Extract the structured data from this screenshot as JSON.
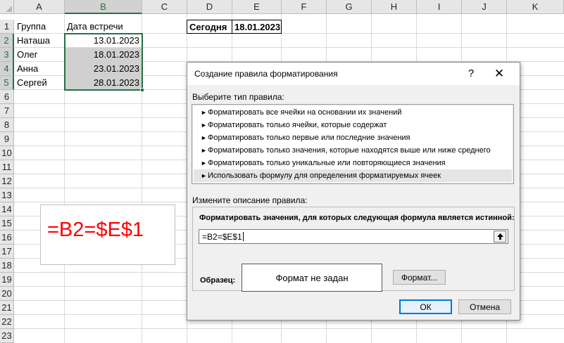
{
  "sheet": {
    "columns": [
      "A",
      "B",
      "C",
      "D",
      "E",
      "F",
      "G",
      "H",
      "I",
      "J",
      "K"
    ],
    "rows": [
      "1",
      "2",
      "3",
      "4",
      "5",
      "6",
      "7",
      "8",
      "9",
      "10",
      "11",
      "12",
      "13",
      "14",
      "15",
      "16",
      "17",
      "18",
      "19",
      "20",
      "21",
      "22",
      "23"
    ],
    "A1": "Группа",
    "B1": "Дата встречи",
    "names": [
      "Наташа",
      "Олег",
      "Анна",
      "Сергей"
    ],
    "dates": [
      "13.01.2023",
      "18.01.2023",
      "23.01.2023",
      "28.01.2023"
    ],
    "D1": "Сегодня",
    "E1": "18.01.2023"
  },
  "annotation": {
    "formula": "=B2=$E$1"
  },
  "dialog": {
    "title": "Создание правила форматирования",
    "help": "?",
    "close": "✕",
    "rule_type_label": "Выберите тип правила:",
    "rule_types": [
      "Форматировать все ячейки на основании их значений",
      "Форматировать только ячейки, которые содержат",
      "Форматировать только первые или последние значения",
      "Форматировать только значения, которые находятся выше или ниже среднего",
      "Форматировать только уникальные или повторяющиеся значения",
      "Использовать формулу для определения форматируемых ячеек"
    ],
    "selected_rule_index": 5,
    "description_label": "Измените описание правила:",
    "formula_heading": "Форматировать значения, для которых следующая формула является истинной:",
    "formula_value": "=B2=$E$1",
    "sample_label": "Образец:",
    "sample_text": "Формат не задан",
    "format_button": "Формат...",
    "ok_button": "ОК",
    "cancel_button": "Отмена"
  },
  "colors": {
    "excel_green": "#217346",
    "formula_red": "#ff0000",
    "selected_fill": "#d0d0d0",
    "ok_border": "#0078d7"
  }
}
